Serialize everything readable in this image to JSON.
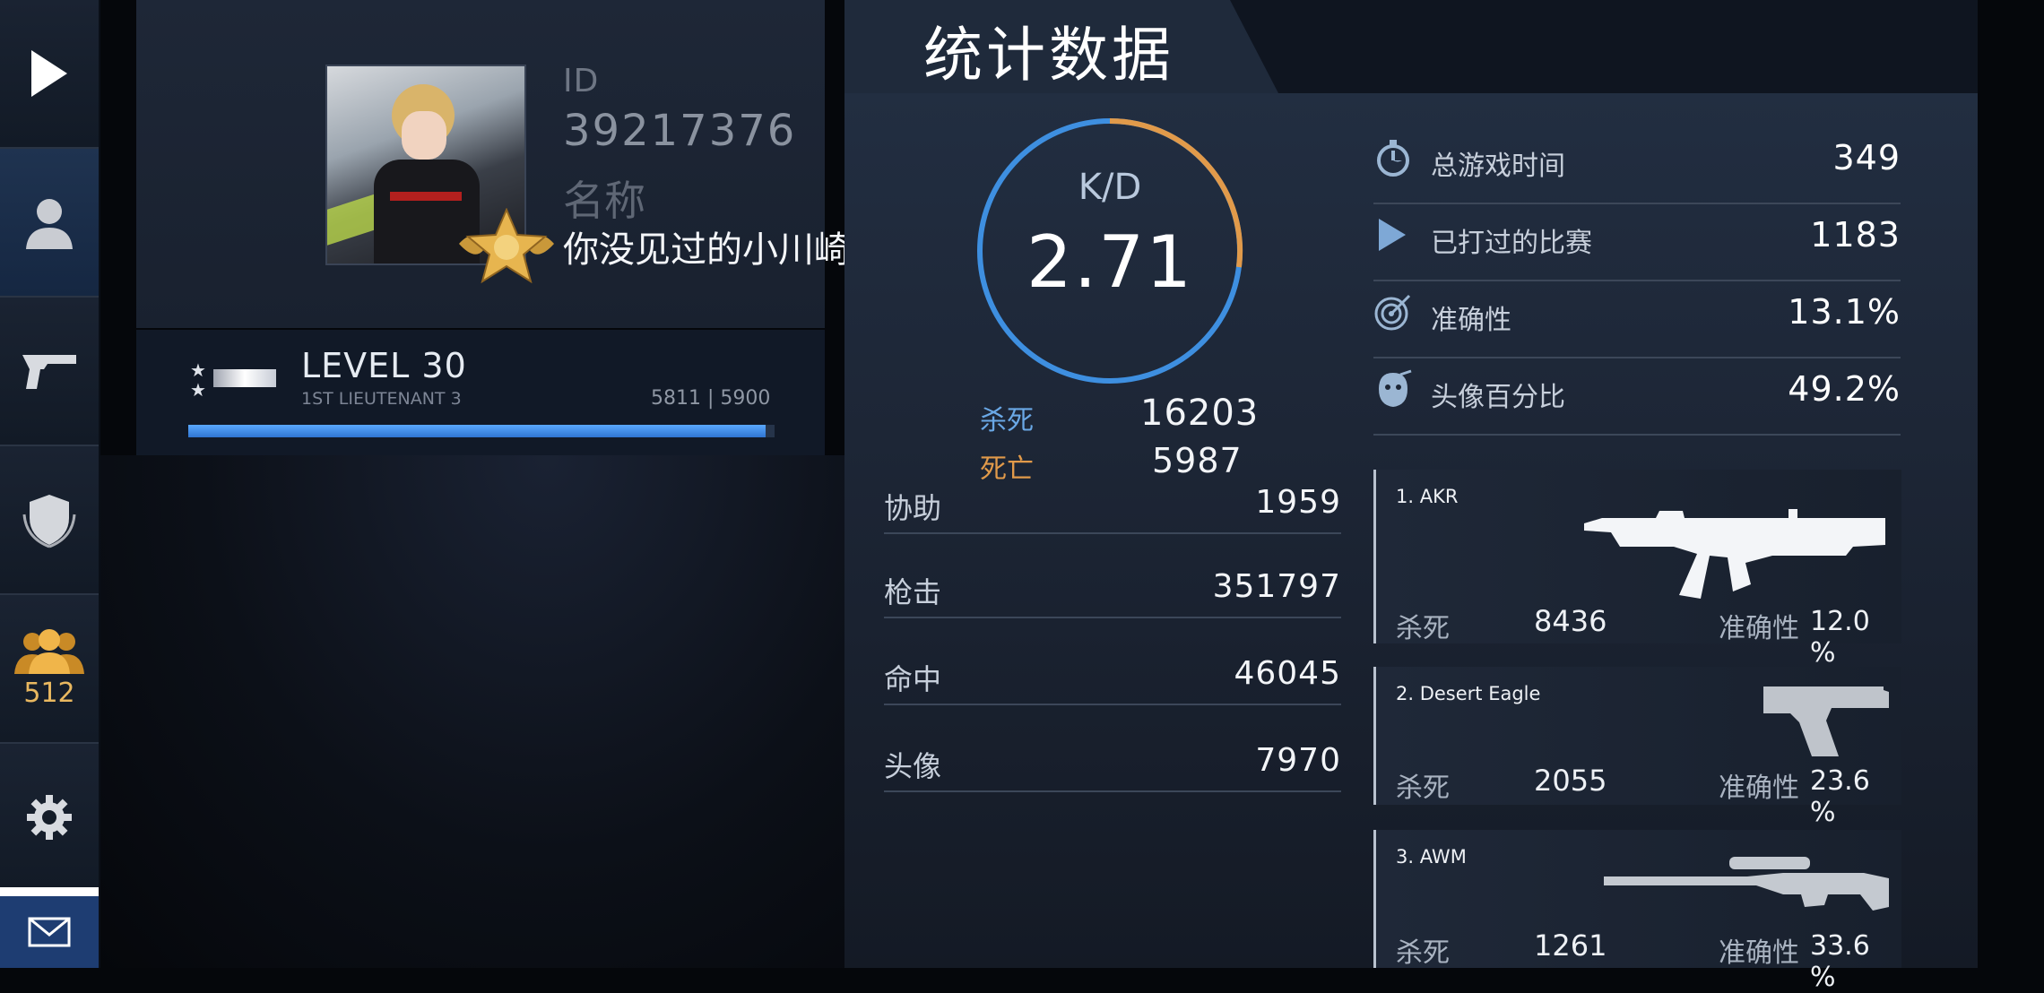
{
  "sidebar": {
    "items": [
      {
        "icon": "play-icon"
      },
      {
        "icon": "profile-icon"
      },
      {
        "icon": "pistol-icon"
      },
      {
        "icon": "shield-icon"
      },
      {
        "icon": "friends-icon",
        "badge": "512"
      },
      {
        "icon": "gear-icon"
      },
      {
        "icon": "mail-icon"
      }
    ]
  },
  "profile": {
    "id_label": "ID",
    "id_value": "39217376",
    "name_label": "名称",
    "name_value": "你没见过的小川崎™♥"
  },
  "level": {
    "title": "LEVEL 30",
    "rank": "1ST LIEUTENANT 3",
    "xp_text": "5811 | 5900",
    "xp_current": 5811,
    "xp_max": 5900
  },
  "stats": {
    "title": "统计数据",
    "kd_label": "K/D",
    "kd_value": "2.71",
    "kills_label": "杀死",
    "kills_value": "16203",
    "deaths_label": "死亡",
    "deaths_value": "5987",
    "details": [
      {
        "label": "协助",
        "value": "1959"
      },
      {
        "label": "枪击",
        "value": "351797"
      },
      {
        "label": "命中",
        "value": "46045"
      },
      {
        "label": "头像",
        "value": "7970"
      }
    ]
  },
  "summary": [
    {
      "icon": "stopwatch-icon",
      "label": "总游戏时间",
      "value": "349"
    },
    {
      "icon": "play-icon",
      "label": "已打过的比赛",
      "value": "1183"
    },
    {
      "icon": "target-icon",
      "label": "准确性",
      "value": "13.1%"
    },
    {
      "icon": "head-icon",
      "label": "头像百分比",
      "value": "49.2%"
    }
  ],
  "weapons": [
    {
      "name": "1. AKR",
      "kills_label": "杀死",
      "kills": "8436",
      "acc_label": "准确性",
      "acc": "12.0 %",
      "icon": "rifle-icon"
    },
    {
      "name": "2. Desert Eagle",
      "kills_label": "杀死",
      "kills": "2055",
      "acc_label": "准确性",
      "acc": "23.6 %",
      "icon": "pistol-icon"
    },
    {
      "name": "3. AWM",
      "kills_label": "杀死",
      "kills": "1261",
      "acc_label": "准确性",
      "acc": "33.6 %",
      "icon": "sniper-icon"
    }
  ],
  "colors": {
    "accent_blue": "#3e8fe0",
    "accent_orange": "#e19a4a",
    "badge_gold": "#e9b860"
  }
}
